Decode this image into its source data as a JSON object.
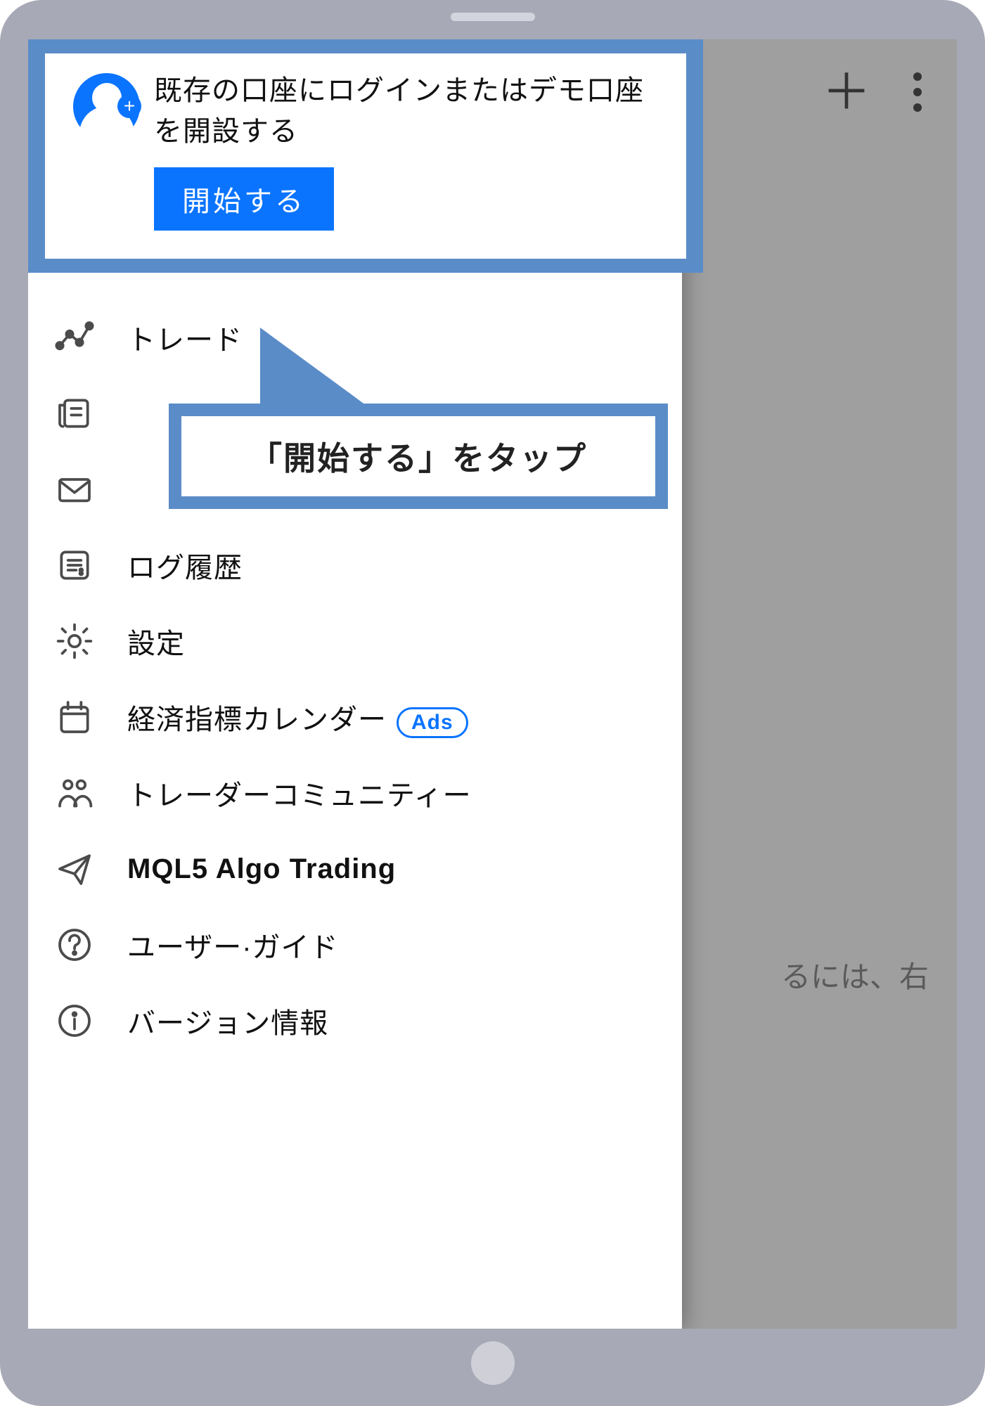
{
  "colors": {
    "accent": "#0b74ff",
    "highlight": "#5a8cc8"
  },
  "background": {
    "hint_text": "るには、右"
  },
  "account": {
    "description": "既存の口座にログインまたはデモ口座を開設する",
    "start_label": "開始する"
  },
  "callout": {
    "text": "「開始する」をタップ"
  },
  "menu": {
    "items": [
      {
        "id": "trade",
        "label": "トレード",
        "icon": "chart-dots-icon"
      },
      {
        "id": "news",
        "label": "",
        "icon": "news-icon"
      },
      {
        "id": "mail",
        "label": "",
        "icon": "mail-icon"
      },
      {
        "id": "logs",
        "label": "ログ履歴",
        "icon": "log-icon"
      },
      {
        "id": "settings",
        "label": "設定",
        "icon": "gear-icon"
      },
      {
        "id": "calendar",
        "label": "経済指標カレンダー",
        "icon": "calendar-icon",
        "ads": true
      },
      {
        "id": "community",
        "label": "トレーダーコミュニティー",
        "icon": "community-icon"
      },
      {
        "id": "mql5",
        "label": "MQL5 Algo Trading",
        "icon": "paper-plane-icon",
        "bold": true
      },
      {
        "id": "guide",
        "label": "ユーザー·ガイド",
        "icon": "help-icon"
      },
      {
        "id": "about",
        "label": "バージョン情報",
        "icon": "info-icon"
      }
    ],
    "ads_label": "Ads"
  }
}
